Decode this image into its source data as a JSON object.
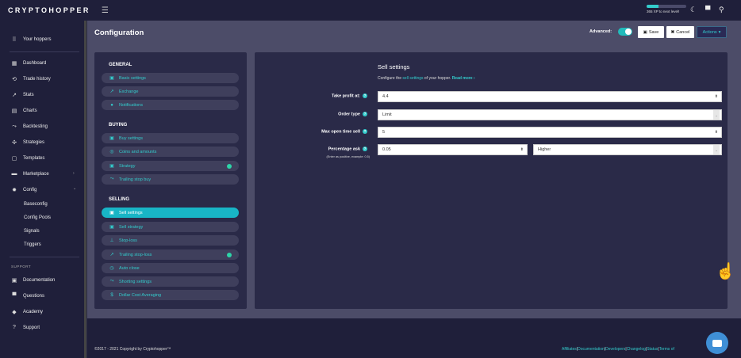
{
  "topbar": {
    "logo": "CRYPTOHOPPER",
    "menu_icon": "hamburger-icon",
    "xp": {
      "progress": 0.3,
      "text": "365 XP to next level!"
    },
    "icons": [
      "moon-icon",
      "chat-icon",
      "user-icon"
    ]
  },
  "sidebar": {
    "your_hoppers": "Your hoppers",
    "items": [
      {
        "label": "Dashboard",
        "icon": "dashboard-icon"
      },
      {
        "label": "Trade history",
        "icon": "history-icon"
      },
      {
        "label": "Stats",
        "icon": "stats-icon"
      },
      {
        "label": "Charts",
        "icon": "charts-icon"
      },
      {
        "label": "Backtesting",
        "icon": "backtesting-icon"
      },
      {
        "label": "Strategies",
        "icon": "strategies-icon"
      },
      {
        "label": "Templates",
        "icon": "templates-icon"
      },
      {
        "label": "Marketplace",
        "icon": "marketplace-icon"
      },
      {
        "label": "Config",
        "icon": "gear-icon"
      }
    ],
    "config_sub": [
      "Baseconfig",
      "Config Pools",
      "Signals",
      "Triggers"
    ],
    "support_label": "SUPPORT",
    "support_items": [
      {
        "label": "Documentation",
        "icon": "documentation-icon"
      },
      {
        "label": "Questions",
        "icon": "questions-icon"
      },
      {
        "label": "Academy",
        "icon": "academy-icon"
      },
      {
        "label": "Support",
        "icon": "support-icon"
      }
    ]
  },
  "header": {
    "title": "Configuration",
    "advanced_label": "Advanced:",
    "advanced_on": true,
    "save_label": "Save",
    "cancel_label": "Cancel",
    "actions_label": "Actions"
  },
  "config_menu": {
    "general": {
      "heading": "GENERAL",
      "items": [
        "Basic settings",
        "Exchange",
        "Notifications"
      ]
    },
    "buying": {
      "heading": "BUYING",
      "items": [
        "Buy settings",
        "Coins and amounts",
        "Strategy",
        "Trailing stop buy"
      ]
    },
    "selling": {
      "heading": "SELLING",
      "items": [
        "Sell settings",
        "Sell strategy",
        "Stop-loss",
        "Trailing stop-loss",
        "Auto close",
        "Shorting settings",
        "Dollar Cost Averaging"
      ]
    }
  },
  "sell_settings": {
    "title": "Sell settings",
    "desc_prefix": "Configure the ",
    "desc_link": "sell settings",
    "desc_suffix": " of your hopper.",
    "read_more": "Read more",
    "fields": {
      "take_profit": {
        "label": "Take profit at:",
        "value": "4.4"
      },
      "order_type": {
        "label": "Order type",
        "value": "Limit"
      },
      "max_open_time": {
        "label": "Max open time sell",
        "value": "5"
      },
      "percentage_ask": {
        "label": "Percentage ask",
        "sub": "(Enter as positive, example: 0.5)",
        "value": "0.05",
        "direction": "Higher"
      }
    }
  },
  "footer": {
    "copyright": "©2017 - 2021 Copyright by Cryptohopper™",
    "links": [
      "Affiliates",
      "Documentation",
      "Developers",
      "Changelog",
      "Status",
      "Terms of"
    ]
  },
  "colors": {
    "accent": "#18b5c6",
    "sidebar_bg": "#1f1f3a",
    "panel_bg": "#2a2a48",
    "content_bg": "#4c4c68"
  }
}
